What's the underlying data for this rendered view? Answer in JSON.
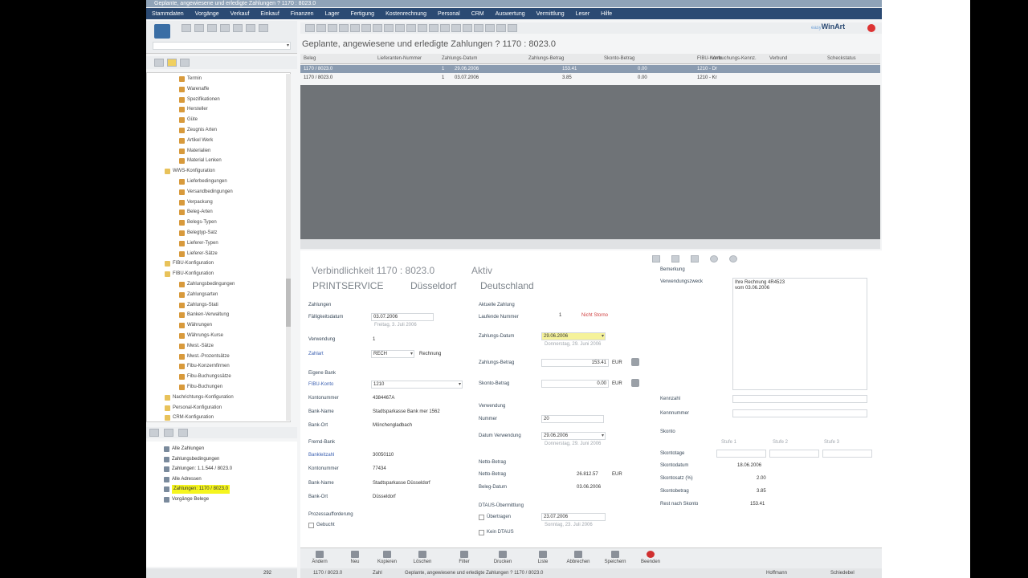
{
  "window": {
    "title": "Geplante, angewiesene und erledigte Zahlungen ? 1170 : 8023.0",
    "logo": "WinArt",
    "logo_prefix": "easy"
  },
  "menu": [
    "Stammdaten",
    "Vorgänge",
    "Verkauf",
    "Einkauf",
    "Finanzen",
    "Lager",
    "Fertigung",
    "Kostenrechnung",
    "Personal",
    "CRM",
    "Auswertung",
    "Vermittlung",
    "Leser",
    "Hilfe"
  ],
  "tree": [
    {
      "label": "Termin",
      "level": 2
    },
    {
      "label": "Warenaffe",
      "level": 2
    },
    {
      "label": "Spezifikationen",
      "level": 2
    },
    {
      "label": "Hersteller",
      "level": 2
    },
    {
      "label": "Güte",
      "level": 2
    },
    {
      "label": "Zeugnis Arten",
      "level": 2
    },
    {
      "label": "Artikel Werk",
      "level": 2
    },
    {
      "label": "Materialien",
      "level": 2
    },
    {
      "label": "Material Lenken",
      "level": 2
    },
    {
      "label": "WWS-Konfiguration",
      "level": 1
    },
    {
      "label": "Lieferbedingungen",
      "level": 2
    },
    {
      "label": "Versandbedingungen",
      "level": 2
    },
    {
      "label": "Verpackung",
      "level": 2
    },
    {
      "label": "Beleg-Arten",
      "level": 2
    },
    {
      "label": "Belegs-Typen",
      "level": 2
    },
    {
      "label": "Belegtyp-Satz",
      "level": 2
    },
    {
      "label": "Lieferer-Typen",
      "level": 2
    },
    {
      "label": "Lieferer-Sätze",
      "level": 2
    },
    {
      "label": "FIBU-Konfiguration",
      "level": 1
    },
    {
      "label": "FIBU-Konfiguration",
      "level": 1
    },
    {
      "label": "Zahlungsbedingungen",
      "level": 2
    },
    {
      "label": "Zahlungsarten",
      "level": 2
    },
    {
      "label": "Zahlungs-Stati",
      "level": 2
    },
    {
      "label": "Banken-Verwaltung",
      "level": 2
    },
    {
      "label": "Währungen",
      "level": 2
    },
    {
      "label": "Währungs-Kurse",
      "level": 2
    },
    {
      "label": "Mwst.-Sätze",
      "level": 2
    },
    {
      "label": "Mwst.-Prozentsätze",
      "level": 2
    },
    {
      "label": "Fibu-Konzernfirmen",
      "level": 2
    },
    {
      "label": "Fibu-Buchungssätze",
      "level": 2
    },
    {
      "label": "Fibu-Buchungen",
      "level": 2
    },
    {
      "label": "Nachrichtungs-Konfiguration",
      "level": 1
    },
    {
      "label": "Personal-Konfiguration",
      "level": 1
    },
    {
      "label": "CRM-Konfiguration",
      "level": 1
    }
  ],
  "history": [
    {
      "label": "Alle Zahlungen",
      "highlight": false
    },
    {
      "label": "Zahlungsbedingungen",
      "highlight": false
    },
    {
      "label": "Zahlungen: 1.1.544 / 8023.0",
      "highlight": false
    },
    {
      "label": "Alle Adressen",
      "highlight": false
    },
    {
      "label": "Zahlungen: 1170 / 8023.0",
      "highlight": true
    },
    {
      "label": "Vorgänge Belege",
      "highlight": false
    }
  ],
  "grid": {
    "headers": [
      "Beleg",
      "Lieferanten-Nummer",
      "Zahlungs-Datum",
      "Zahlungs-Betrag",
      "Skonto-Betrag",
      "FIBU-Konto",
      "Verbuchungs-Kennz.",
      "Verbund",
      "Scheckstatus"
    ],
    "rows": [
      {
        "beleg": "1170 / 8023.0",
        "nr": "1",
        "datum": "29.06.2006",
        "betrag": "153.41",
        "skonto": "0.00",
        "konto": "1210 - Dr",
        "selected": true
      },
      {
        "beleg": "1170 / 8023.0",
        "nr": "1",
        "datum": "03.07.2006",
        "betrag": "3.85",
        "skonto": "0.00",
        "konto": "1210 - Kr",
        "selected": false
      }
    ]
  },
  "detail": {
    "title": "Verbindlichkeit  1170 : 8023.0",
    "status": "Aktiv",
    "company": "PRINTSERVICE",
    "city": "Düsseldorf",
    "country": "Deutschland",
    "left": {
      "section": "Zahlungen",
      "faelligkeit_label": "Fälligkeitsdatum",
      "faelligkeit": "03.07.2006",
      "faelligkeit_sub": "Freitag, 3. Juli 2006",
      "verwendung_label": "Verwendung",
      "verwendung": "1",
      "zahlart_label": "Zahlart",
      "zahlart": "RECH",
      "zahlart_text": "Rechnung",
      "eigene_bank_label": "Eigene Bank",
      "fibu_konto_label": "FIBU-Konto",
      "fibu_konto": "1210",
      "kontonummer_label": "Kontonummer",
      "kontonummer": "4384467A",
      "bankname_label": "Bank-Name",
      "bankname": "Stadtsparkasse Bank mer 1562",
      "bankort_label": "Bank-Ort",
      "bankort": "Mönchengladbach",
      "fremd_bank_label": "Fremd-Bank",
      "bankleitzahl_label": "Bankleitzahl",
      "bankleitzahl": "30050110",
      "fkonto_label": "Kontonummer",
      "fkonto": "77434",
      "fbankname_label": "Bank-Name",
      "fbankname": "Stadtsparkasse Düsseldorf",
      "fbankort_label": "Bank-Ort",
      "fbankort": "Düsseldorf",
      "prozess_label": "Prozessaufforderung",
      "gebucht_label": "Gebucht"
    },
    "mid": {
      "section": "Aktuelle Zahlung",
      "lfdnr_label": "Laufende Nummer",
      "lfdnr": "1",
      "storno_label": "Nicht Storno",
      "datum_label": "Zahlungs-Datum",
      "datum": "29.06.2006",
      "datum_sub": "Donnerstag, 29. Juni 2006",
      "betrag_label": "Zahlungs-Betrag",
      "betrag": "153.41",
      "currency": "EUR",
      "skonto_label": "Skonto-Betrag",
      "skonto": "0.00",
      "verwendung_section": "Verwendung",
      "nummer_label": "Nummer",
      "nummer": "20",
      "datum_verw_label": "Datum Verwendung",
      "datum_verw": "29.06.2006",
      "datum_verw_sub": "Donnerstag, 29. Juni 2006",
      "netto_section": "Netto-Betrag",
      "netto_label": "Netto-Betrag",
      "netto": "26.812.57",
      "netto_cur": "EUR",
      "beleg_datum_label": "Beleg-Datum",
      "beleg_datum": "03.06.2006",
      "dtaus_section": "DTAUS-Übermittlung",
      "dtaus_label": "Übertragen",
      "dtaus_datum": "23.07.2006",
      "dtaus_sub": "Sonntag, 23. Juli 2006",
      "kein_dtaus": "Kein DTAUS"
    },
    "right": {
      "bemerkung_label": "Bemerkung",
      "verwendungszweck_label": "Verwendungszweck",
      "note": "Ihre Rechnung 4R4523\nvom 03.06.2006",
      "kennzahl_label": "Kennzahl",
      "kennnummer_label": "Kennnummer",
      "skonto_label": "Skonto",
      "col1": "Stufe 1",
      "col2": "Stufe 2",
      "col3": "Stufe 3",
      "skontotage_label": "Skontotage",
      "skontodatum_label": "Skontodatum",
      "skontodatum": "18.06.2006",
      "skontosatz_label": "Skontosatz (%)",
      "skontosatz": "2.00",
      "skontobetrag_label": "Skontobetrag",
      "skontobetrag": "3.85",
      "rest_label": "Rest nach Skonto",
      "rest": "153.41"
    }
  },
  "actions": [
    "Ändern",
    "Neu",
    "Kopieren",
    "Löschen",
    "Filter",
    "Drucken",
    "Liste",
    "Abbrechen",
    "Speichern",
    "Beenden"
  ],
  "status": {
    "rec": "1170 / 8023.0",
    "mode": "Zahl",
    "text": "Geplante, angewiesene und erledigte Zahlungen ? 1170 / 8023.0",
    "count": "292",
    "user": "Hoffmann",
    "dept": "Schiedebel"
  }
}
